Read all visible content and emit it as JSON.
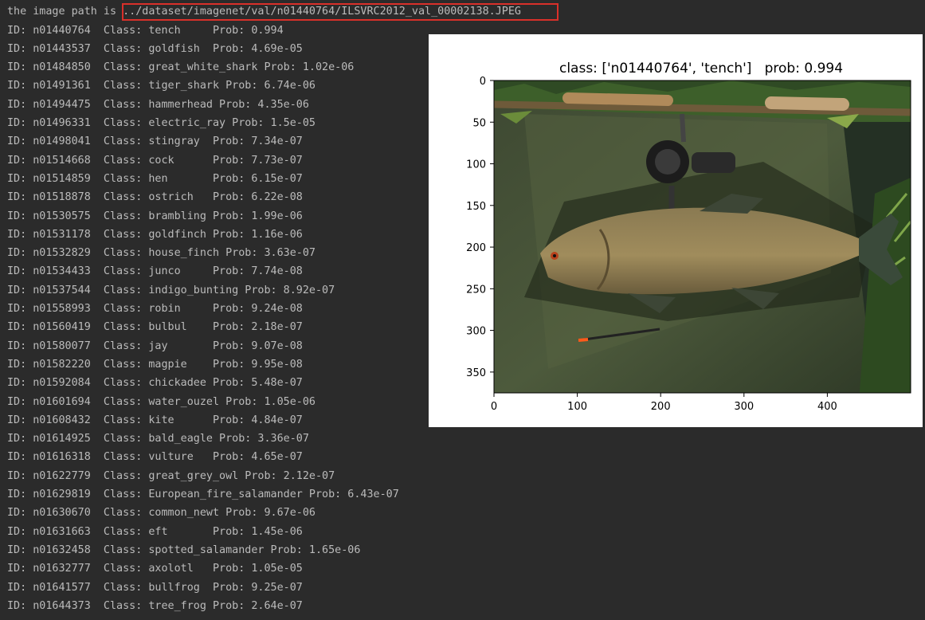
{
  "terminal": {
    "path_prefix": "the image path is ",
    "image_path": "../dataset/imagenet/val/n01440764/ILSVRC2012_val_00002138.JPEG",
    "id_label": "ID:",
    "class_label": "Class:",
    "prob_label": "Prob:",
    "rows": [
      {
        "id": "n01440764",
        "cls": "tench",
        "prob": "0.994"
      },
      {
        "id": "n01443537",
        "cls": "goldfish",
        "prob": "4.69e-05"
      },
      {
        "id": "n01484850",
        "cls": "great_white_shark",
        "prob": "1.02e-06"
      },
      {
        "id": "n01491361",
        "cls": "tiger_shark",
        "prob": "6.74e-06"
      },
      {
        "id": "n01494475",
        "cls": "hammerhead",
        "prob": "4.35e-06"
      },
      {
        "id": "n01496331",
        "cls": "electric_ray",
        "prob": "1.5e-05"
      },
      {
        "id": "n01498041",
        "cls": "stingray",
        "prob": "7.34e-07"
      },
      {
        "id": "n01514668",
        "cls": "cock",
        "prob": "7.73e-07"
      },
      {
        "id": "n01514859",
        "cls": "hen",
        "prob": "6.15e-07"
      },
      {
        "id": "n01518878",
        "cls": "ostrich",
        "prob": "6.22e-08"
      },
      {
        "id": "n01530575",
        "cls": "brambling",
        "prob": "1.99e-06"
      },
      {
        "id": "n01531178",
        "cls": "goldfinch",
        "prob": "1.16e-06"
      },
      {
        "id": "n01532829",
        "cls": "house_finch",
        "prob": "3.63e-07"
      },
      {
        "id": "n01534433",
        "cls": "junco",
        "prob": "7.74e-08"
      },
      {
        "id": "n01537544",
        "cls": "indigo_bunting",
        "prob": "8.92e-07"
      },
      {
        "id": "n01558993",
        "cls": "robin",
        "prob": "9.24e-08"
      },
      {
        "id": "n01560419",
        "cls": "bulbul",
        "prob": "2.18e-07"
      },
      {
        "id": "n01580077",
        "cls": "jay",
        "prob": "9.07e-08"
      },
      {
        "id": "n01582220",
        "cls": "magpie",
        "prob": "9.95e-08"
      },
      {
        "id": "n01592084",
        "cls": "chickadee",
        "prob": "5.48e-07"
      },
      {
        "id": "n01601694",
        "cls": "water_ouzel",
        "prob": "1.05e-06"
      },
      {
        "id": "n01608432",
        "cls": "kite",
        "prob": "4.84e-07"
      },
      {
        "id": "n01614925",
        "cls": "bald_eagle",
        "prob": "3.36e-07"
      },
      {
        "id": "n01616318",
        "cls": "vulture",
        "prob": "4.65e-07"
      },
      {
        "id": "n01622779",
        "cls": "great_grey_owl",
        "prob": "2.12e-07"
      },
      {
        "id": "n01629819",
        "cls": "European_fire_salamander",
        "prob": "6.43e-07"
      },
      {
        "id": "n01630670",
        "cls": "common_newt",
        "prob": "9.67e-06"
      },
      {
        "id": "n01631663",
        "cls": "eft",
        "prob": "1.45e-06"
      },
      {
        "id": "n01632458",
        "cls": "spotted_salamander",
        "prob": "1.65e-06"
      },
      {
        "id": "n01632777",
        "cls": "axolotl",
        "prob": "1.05e-05"
      },
      {
        "id": "n01641577",
        "cls": "bullfrog",
        "prob": "9.25e-07"
      },
      {
        "id": "n01644373",
        "cls": "tree_frog",
        "prob": "2.64e-07"
      }
    ]
  },
  "figure": {
    "title": "class: ['n01440764', 'tench']   prob: 0.994",
    "image_content": "photo of a tench fish lying on a green mat beside a fishing rod and reel",
    "x_ticks": [
      "0",
      "100",
      "200",
      "300",
      "400"
    ],
    "y_ticks": [
      "0",
      "50",
      "100",
      "150",
      "200",
      "250",
      "300",
      "350"
    ],
    "x_range": [
      0,
      500
    ],
    "y_range": [
      0,
      375
    ]
  },
  "colors": {
    "terminal_bg": "#2b2b2b",
    "terminal_text": "#bbbbbb",
    "highlight_box": "#d9302a"
  }
}
